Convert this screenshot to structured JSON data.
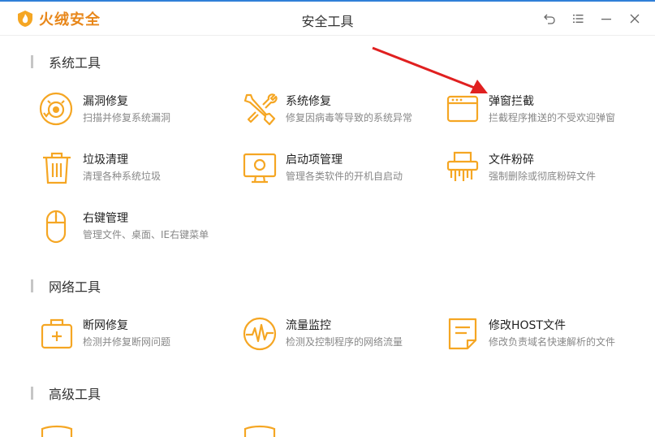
{
  "app": {
    "brand": "火绒安全",
    "window_title": "安全工具"
  },
  "colors": {
    "accent": "#F5A623",
    "brand": "#E8871A",
    "arrow": "#E02020",
    "topbar": "#2F7FD8"
  },
  "window_controls": [
    {
      "name": "back-icon"
    },
    {
      "name": "menu-icon"
    },
    {
      "name": "minimize-icon"
    },
    {
      "name": "close-icon"
    }
  ],
  "sections": {
    "system": {
      "title": "系统工具",
      "items": [
        {
          "name": "漏洞修复",
          "desc": "扫描并修复系统漏洞",
          "icon": "vulnerability-fix-icon"
        },
        {
          "name": "系统修复",
          "desc": "修复因病毒等导致的系统异常",
          "icon": "system-repair-icon"
        },
        {
          "name": "弹窗拦截",
          "desc": "拦截程序推送的不受欢迎弹窗",
          "icon": "popup-block-icon"
        },
        {
          "name": "垃圾清理",
          "desc": "清理各种系统垃圾",
          "icon": "trash-icon"
        },
        {
          "name": "启动项管理",
          "desc": "管理各类软件的开机自启动",
          "icon": "startup-monitor-icon"
        },
        {
          "name": "文件粉碎",
          "desc": "强制删除或彻底粉碎文件",
          "icon": "file-shredder-icon"
        },
        {
          "name": "右键管理",
          "desc": "管理文件、桌面、IE右键菜单",
          "icon": "mouse-icon"
        }
      ]
    },
    "network": {
      "title": "网络工具",
      "items": [
        {
          "name": "断网修复",
          "desc": "检测并修复断网问题",
          "icon": "network-repair-icon"
        },
        {
          "name": "流量监控",
          "desc": "检测及控制程序的网络流量",
          "icon": "traffic-monitor-icon"
        },
        {
          "name": "修改HOST文件",
          "desc": "修改负责域名快速解析的文件",
          "icon": "host-file-icon"
        }
      ]
    },
    "advanced": {
      "title": "高级工具"
    }
  }
}
